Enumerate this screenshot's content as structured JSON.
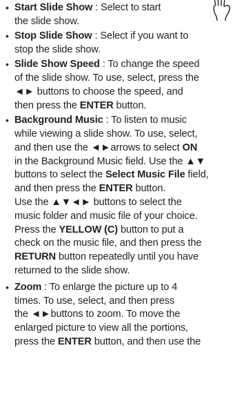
{
  "colors": {
    "text": "#231f20",
    "background": "#ffffff"
  },
  "icons": {
    "hand": "hand-pointer-icon"
  },
  "bullet_char": "•",
  "items": [
    {
      "term": "Start Slide Show",
      "lines": [
        [
          {
            "t": " : Select to start",
            "b": false
          }
        ],
        [
          {
            "t": "the slide show.",
            "b": false
          }
        ]
      ]
    },
    {
      "term": "Stop Slide Show",
      "lines": [
        [
          {
            "t": " : Select if you want to",
            "b": false
          }
        ],
        [
          {
            "t": "stop the slide show.",
            "b": false
          }
        ]
      ]
    },
    {
      "term": "Slide Show Speed",
      "lines": [
        [
          {
            "t": " : To change the speed",
            "b": false
          }
        ],
        [
          {
            "t": "of the slide show. To use, select, press the",
            "b": false
          }
        ],
        [
          {
            "t": "◄► buttons to choose the speed, and",
            "b": false
          }
        ],
        [
          {
            "t": "then press the ",
            "b": false
          },
          {
            "t": "ENTER",
            "b": true
          },
          {
            "t": " button.",
            "b": false
          }
        ]
      ]
    },
    {
      "term": "Background Music",
      "lines": [
        [
          {
            "t": " : To listen to music",
            "b": false
          }
        ],
        [
          {
            "t": "while viewing a slide show. To use, select,",
            "b": false
          }
        ],
        [
          {
            "t": "and then use the ◄►arrows to select ",
            "b": false
          },
          {
            "t": "ON",
            "b": true
          }
        ],
        [
          {
            "t": "in the Background Music field. Use the ▲▼",
            "b": false
          }
        ],
        [
          {
            "t": "buttons to select the ",
            "b": false
          },
          {
            "t": "Select Music File",
            "b": true
          },
          {
            "t": " field,",
            "b": false
          }
        ],
        [
          {
            "t": "and then press the ",
            "b": false
          },
          {
            "t": "ENTER",
            "b": true
          },
          {
            "t": " button.",
            "b": false
          }
        ],
        [
          {
            "t": "Use the ▲▼◄► buttons to select the",
            "b": false
          }
        ],
        [
          {
            "t": "music folder and music file of your choice.",
            "b": false
          }
        ],
        [
          {
            "t": "Press the ",
            "b": false
          },
          {
            "t": "YELLOW (C)",
            "b": true
          },
          {
            "t": " button to put a",
            "b": false
          }
        ],
        [
          {
            "t": "check on the music file, and then press the",
            "b": false
          }
        ],
        [
          {
            "t": "RETURN",
            "b": true
          },
          {
            "t": " button repeatedly until you have",
            "b": false
          }
        ],
        [
          {
            "t": "returned to the slide show.",
            "b": false
          }
        ]
      ]
    },
    {
      "term": "Zoom",
      "lines": [
        [
          {
            "t": " : To enlarge the picture up to 4",
            "b": false
          }
        ],
        [
          {
            "t": "times. To use, select, and then press",
            "b": false
          }
        ],
        [
          {
            "t": "the ◄►buttons to zoom. To move the",
            "b": false
          }
        ],
        [
          {
            "t": "enlarged picture to view all the portions,",
            "b": false
          }
        ],
        [
          {
            "t": "press the ",
            "b": false
          },
          {
            "t": "ENTER",
            "b": true
          },
          {
            "t": " button, and then use the",
            "b": false
          }
        ]
      ]
    }
  ]
}
